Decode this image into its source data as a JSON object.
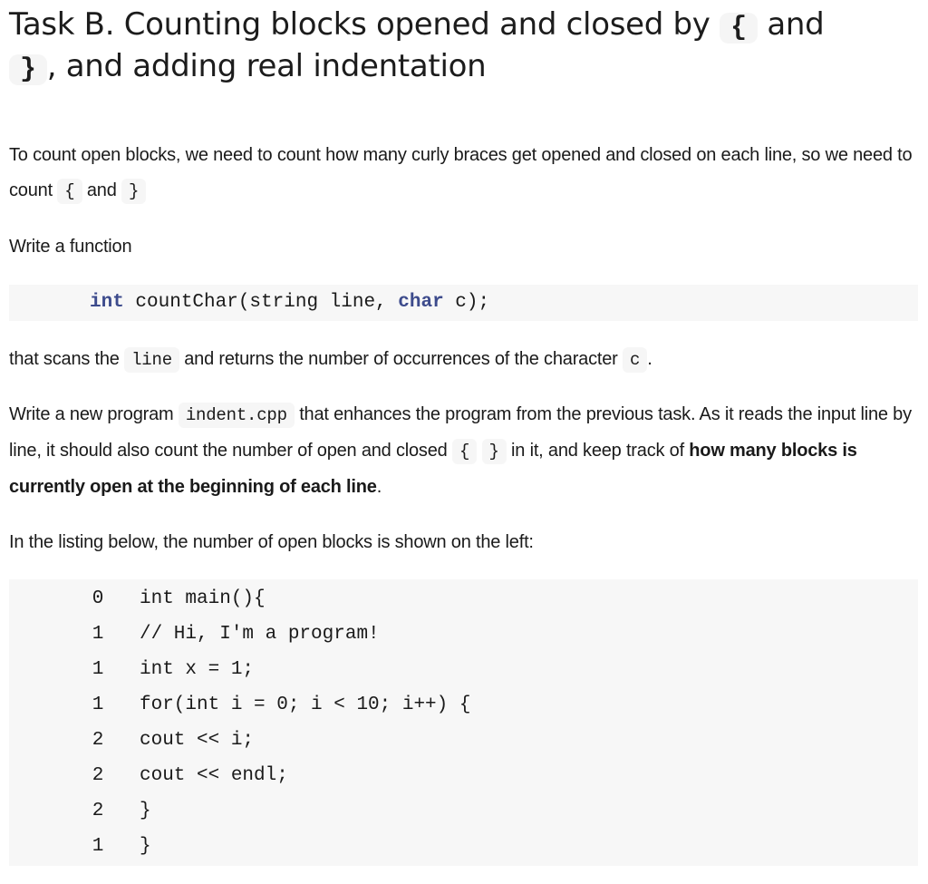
{
  "title": {
    "part1": "Task B. Counting blocks opened and closed by ",
    "open_brace": "{",
    "part2": " and ",
    "close_brace": "}",
    "part3": ", and adding real indentation"
  },
  "intro": {
    "text1": "To count open blocks, we need to count how many curly braces get opened and closed on each line, so we need to count ",
    "code1": "{",
    "text2": " and ",
    "code2": "}"
  },
  "write_function": "Write a function",
  "signature": {
    "kw_int": "int",
    "mid": " countChar(string line, ",
    "kw_char": "char",
    "end": " c);"
  },
  "scans": {
    "text1": "that scans the ",
    "code1": "line",
    "text2": " and returns the number of occurrences of the character ",
    "code2": "c",
    "text3": "."
  },
  "new_program": {
    "text1": "Write a new program ",
    "code1": "indent.cpp",
    "text2": " that enhances the program from the previous task. As it reads the input line by line, it should also count the number of open and closed ",
    "code2": "{",
    "code3": "}",
    "text3": " in it, and keep track of ",
    "bold": "how many blocks is currently open at the beginning of each line",
    "text4": "."
  },
  "listing_intro": "In the listing below, the number of open blocks is shown on the left:",
  "listing": [
    {
      "count": "0",
      "code": "int main(){"
    },
    {
      "count": "1",
      "code": "// Hi, I'm a program!"
    },
    {
      "count": "1",
      "code": "int x = 1;"
    },
    {
      "count": "1",
      "code": "for(int i = 0; i < 10; i++) {"
    },
    {
      "count": "2",
      "code": "cout << i;"
    },
    {
      "count": "2",
      "code": "cout << endl;"
    },
    {
      "count": "2",
      "code": "}"
    },
    {
      "count": "1",
      "code": "}"
    }
  ],
  "colors": {
    "keyword": "#3d4b8c",
    "code_background": "#f7f7f7"
  }
}
